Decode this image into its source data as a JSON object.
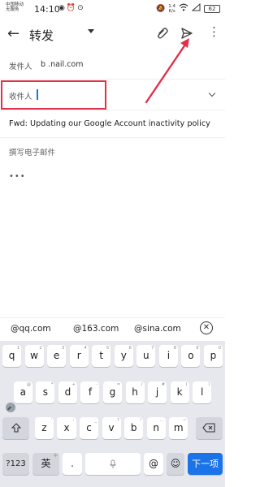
{
  "status_bar": {
    "carrier_line1": "中国移动",
    "carrier_line2": "无服务",
    "time": "14:10",
    "speed_value": "1.4",
    "speed_unit": "K/s",
    "battery": "62"
  },
  "app_bar": {
    "title": "转发"
  },
  "form": {
    "from_label": "发件人",
    "from_value": "b                 .nail.com",
    "to_label": "收件人",
    "to_value": "",
    "subject": "Fwd: Updating our Google Account inactivity policy",
    "compose_placeholder": "撰写电子邮件",
    "quoted_dots": "•••"
  },
  "suggestions": [
    "@qq.com",
    "@163.com",
    "@sina.com"
  ],
  "keyboard": {
    "row1": [
      {
        "k": "q",
        "h": "1"
      },
      {
        "k": "w",
        "h": "2"
      },
      {
        "k": "e",
        "h": "3"
      },
      {
        "k": "r",
        "h": "4"
      },
      {
        "k": "t",
        "h": "5"
      },
      {
        "k": "y",
        "h": "6"
      },
      {
        "k": "u",
        "h": "7"
      },
      {
        "k": "i",
        "h": "8"
      },
      {
        "k": "o",
        "h": "9"
      },
      {
        "k": "p",
        "h": "0"
      }
    ],
    "row2": [
      {
        "k": "a",
        "h": "@"
      },
      {
        "k": "s",
        "h": "*"
      },
      {
        "k": "d",
        "h": "+"
      },
      {
        "k": "f",
        "h": "-"
      },
      {
        "k": "g",
        "h": "="
      },
      {
        "k": "h",
        "h": "/"
      },
      {
        "k": "j",
        "h": "#"
      },
      {
        "k": "k",
        "h": "("
      },
      {
        "k": "l",
        "h": ")"
      }
    ],
    "row3": [
      {
        "k": "z",
        "h": "'"
      },
      {
        "k": "x",
        "h": ":"
      },
      {
        "k": "c",
        "h": "_"
      },
      {
        "k": "v",
        "h": "?"
      },
      {
        "k": "b",
        "h": "!"
      },
      {
        "k": "n",
        "h": "…"
      },
      {
        "k": "m",
        "h": "~"
      }
    ],
    "sym_label": "?123",
    "lang_label": "英",
    "lang_sub": "中",
    "dot_label": ".",
    "at_label": "@",
    "enter_label": "下一项"
  },
  "colors": {
    "accent": "#1a73e8",
    "highlight_box": "#e0304a",
    "annotation_arrow": "#e0304a"
  }
}
